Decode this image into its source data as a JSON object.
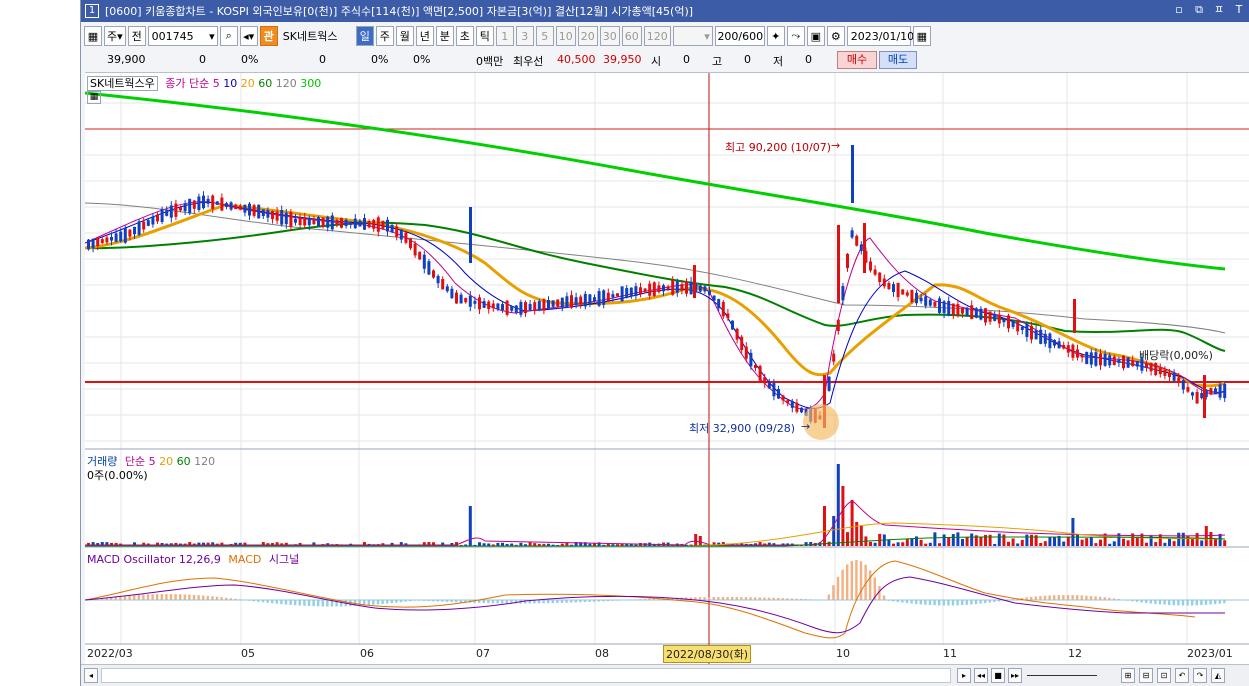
{
  "title": {
    "num": "1",
    "text": "[0600] 키움종합차트 - KOSPI 외국인보유[0(천)] 주식수[114(천)] 액면[2,500] 자본금[3(억)] 결산[12월] 시가총액[45(억)]"
  },
  "toolbar": {
    "period": "주",
    "prev": "전",
    "code": "001745",
    "badge": "관",
    "name": "SK네트웍스",
    "periods": [
      "일",
      "주",
      "월",
      "년",
      "분",
      "초",
      "틱"
    ],
    "intervals": [
      "1",
      "3",
      "5",
      "10",
      "20",
      "30",
      "60",
      "120"
    ],
    "count": "200/600",
    "date": "2023/01/10"
  },
  "quote": {
    "price": "39,900",
    "chg": "0",
    "chg_pct": "0%",
    "vol": "0",
    "vol_pct": "0%",
    "trade": "0%",
    "amount": "0백만",
    "best_label": "최우선",
    "ask": "40,500",
    "bid": "39,950",
    "open_l": "시",
    "open": "0",
    "high_l": "고",
    "high": "0",
    "low_l": "저",
    "low": "0",
    "buy": "매수",
    "sell": "매도"
  },
  "legend": {
    "name": "SK네트웍스우",
    "ma_label": "종가 단순",
    "ma": [
      "5",
      "10",
      "20",
      "60",
      "120",
      "300"
    ],
    "ma_colors": [
      "#c00090",
      "#0000c8",
      "#e8a000",
      "#008000",
      "#808080",
      "#00c800"
    ]
  },
  "annot": {
    "high": "최고 90,200 (10/07)",
    "low": "최저 32,900 (09/28)",
    "div": "배당락(0,00%)"
  },
  "volume": {
    "label": "거래량",
    "ma_label": "단순",
    "ma": [
      "5",
      "20",
      "60",
      "120"
    ],
    "value": "0주(0.00%)"
  },
  "macd": {
    "osc": "MACD Oscillator 12,26,9",
    "macd": "MACD",
    "sig": "시그널"
  },
  "xaxis": {
    "labels": [
      "2022/03",
      "05",
      "06",
      "07",
      "08",
      "10",
      "11",
      "12",
      "2023/01"
    ],
    "cursor": "2022/08/30(화)"
  },
  "chart_data": {
    "type": "candlestick",
    "price_range": [
      30000,
      95000
    ],
    "high": {
      "value": 90200,
      "date": "10/07"
    },
    "low": {
      "value": 32900,
      "date": "09/28"
    }
  }
}
